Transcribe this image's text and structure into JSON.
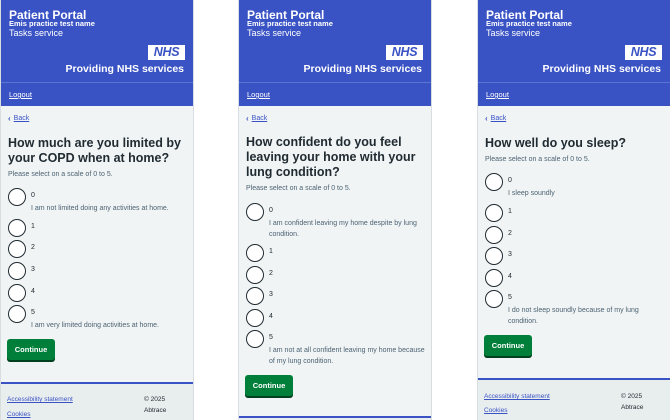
{
  "header": {
    "title": "Patient Portal",
    "practice": "Emis practice test name",
    "service": "Tasks service",
    "nhs_logo": "NHS",
    "providing": "Providing NHS services",
    "logout": "Logout"
  },
  "back_label": "Back",
  "hint": "Please select on a scale of 0 to 5.",
  "continue_label": "Continue",
  "footer": {
    "accessibility": "Accessibility statement",
    "cookies": "Cookies",
    "copyright": "© 2025",
    "company": "Abtrace"
  },
  "panels": [
    {
      "question": "How much are you limited by your COPD when at home?",
      "options": [
        {
          "value": "0",
          "desc": "I am not limited doing any activities at home."
        },
        {
          "value": "1",
          "desc": ""
        },
        {
          "value": "2",
          "desc": ""
        },
        {
          "value": "3",
          "desc": ""
        },
        {
          "value": "4",
          "desc": ""
        },
        {
          "value": "5",
          "desc": "I am very limited doing activities at home."
        }
      ]
    },
    {
      "question": "How confident do you feel leaving your home with your lung condition?",
      "options": [
        {
          "value": "0",
          "desc": "I am confident leaving my home despite by lung condition."
        },
        {
          "value": "1",
          "desc": ""
        },
        {
          "value": "2",
          "desc": ""
        },
        {
          "value": "3",
          "desc": ""
        },
        {
          "value": "4",
          "desc": ""
        },
        {
          "value": "5",
          "desc": "I am not at all confident leaving my home because of my lung condition."
        }
      ]
    },
    {
      "question": "How well do you sleep?",
      "options": [
        {
          "value": "0",
          "desc": "I sleep soundly"
        },
        {
          "value": "1",
          "desc": ""
        },
        {
          "value": "2",
          "desc": ""
        },
        {
          "value": "3",
          "desc": ""
        },
        {
          "value": "4",
          "desc": ""
        },
        {
          "value": "5",
          "desc": "I do not sleep soundly because of my lung condition."
        }
      ]
    }
  ],
  "colors": {
    "header_blue": "#3a53c4",
    "button_green": "#007f3b",
    "background": "#f0f4f5"
  }
}
